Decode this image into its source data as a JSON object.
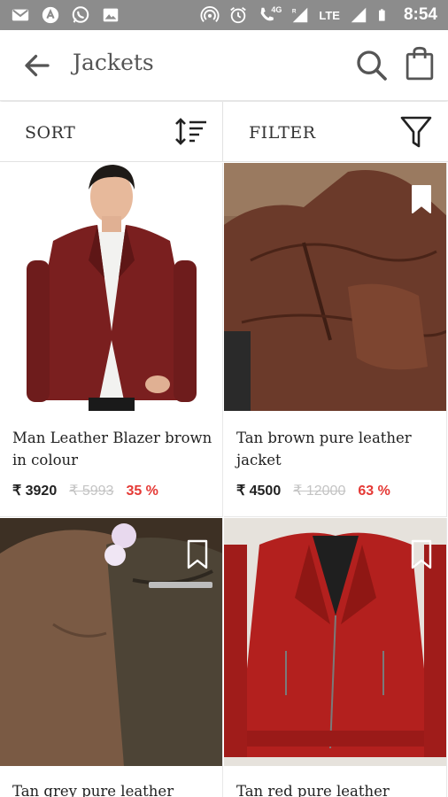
{
  "status_bar": {
    "time": "8:54",
    "network_label": "LTE",
    "signal_label": "4G",
    "left_icons": [
      "gmail-icon",
      "app-icon",
      "whatsapp-icon",
      "gallery-icon"
    ],
    "right_icons": [
      "hotspot-icon",
      "alarm-icon",
      "wifi-call-icon",
      "signal-icon",
      "battery-icon"
    ]
  },
  "header": {
    "title": "Jackets"
  },
  "toolbar": {
    "sort_label": "SORT",
    "filter_label": "FILTER"
  },
  "products": [
    {
      "name": "Man Leather Blazer brown in colour",
      "price": "₹ 3920",
      "mrp": "₹ 5993",
      "discount": "35 %",
      "color": "#7a1f1f"
    },
    {
      "name": "Tan brown  pure leather jacket",
      "price": "₹ 4500",
      "mrp": "₹ 12000",
      "discount": "63 %",
      "color": "#6b3a2a"
    },
    {
      "name": "Tan grey pure leather",
      "price": "",
      "mrp": "",
      "discount": "",
      "color": "#4a3a2a"
    },
    {
      "name": "Tan red pure leather",
      "price": "",
      "mrp": "",
      "discount": "",
      "color": "#b3201e"
    }
  ],
  "colors": {
    "status_bar": "#8c8c8c",
    "discount": "#e53935",
    "mrp": "#c4c4c4"
  }
}
